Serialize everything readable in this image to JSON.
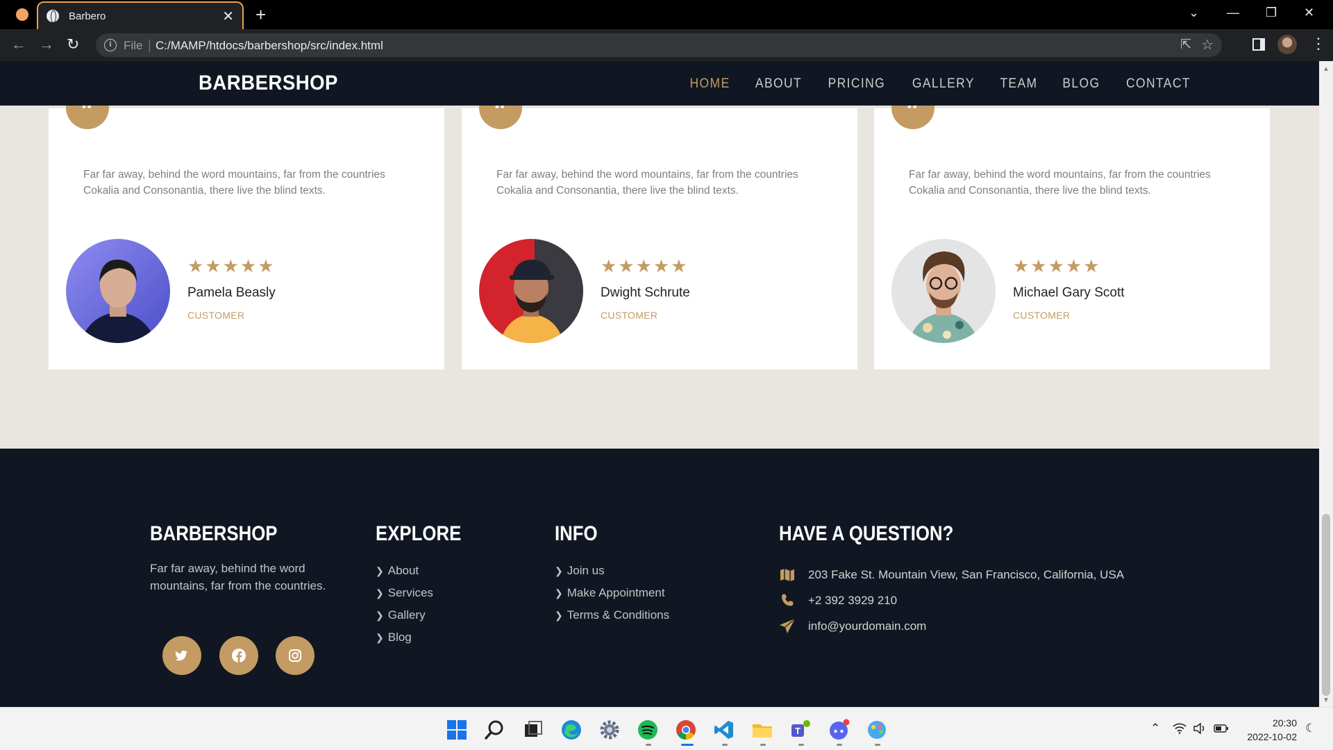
{
  "browser": {
    "tab_title": "Barbero",
    "close_tab": "✕",
    "new_tab": "+",
    "url_scheme": "File",
    "url": "C:/MAMP/htdocs/barbershop/src/index.html"
  },
  "site": {
    "brand": "BARBERSHOP",
    "nav": [
      {
        "label": "HOME",
        "active": true
      },
      {
        "label": "ABOUT"
      },
      {
        "label": "PRICING"
      },
      {
        "label": "GALLERY"
      },
      {
        "label": "TEAM"
      },
      {
        "label": "BLOG"
      },
      {
        "label": "CONTACT"
      }
    ]
  },
  "testimonials": [
    {
      "text": "Far far away, behind the word mountains, far from the countries Cokalia and Consonantia, there live the blind texts.",
      "rating": 5,
      "stars": "★★★★★",
      "name": "Pamela Beasly",
      "role": "CUSTOMER"
    },
    {
      "text": "Far far away, behind the word mountains, far from the countries Cokalia and Consonantia, there live the blind texts.",
      "rating": 5,
      "stars": "★★★★★",
      "name": "Dwight Schrute",
      "role": "CUSTOMER"
    },
    {
      "text": "Far far away, behind the word mountains, far from the countries Cokalia and Consonantia, there live the blind texts.",
      "rating": 5,
      "stars": "★★★★★",
      "name": "Michael Gary Scott",
      "role": "CUSTOMER"
    }
  ],
  "footer": {
    "brand": "BARBERSHOP",
    "about": "Far far away, behind the word mountains, far from the countries.",
    "social": [
      "twitter-icon",
      "facebook-icon",
      "instagram-icon"
    ],
    "explore": {
      "title": "EXPLORE",
      "links": [
        "About",
        "Services",
        "Gallery",
        "Blog"
      ]
    },
    "info": {
      "title": "INFO",
      "links": [
        "Join us",
        "Make Appointment",
        "Terms & Conditions"
      ]
    },
    "question": {
      "title": "HAVE A QUESTION?",
      "address": "203 Fake St. Mountain View, San Francisco, California, USA",
      "phone": "+2 392 3929 210",
      "email": "info@yourdomain.com"
    }
  },
  "taskbar": {
    "time": "20:30",
    "date": "2022-10-02"
  },
  "colors": {
    "accent": "#c49b63",
    "dark": "#111722",
    "page_bg": "#e9e6df"
  }
}
